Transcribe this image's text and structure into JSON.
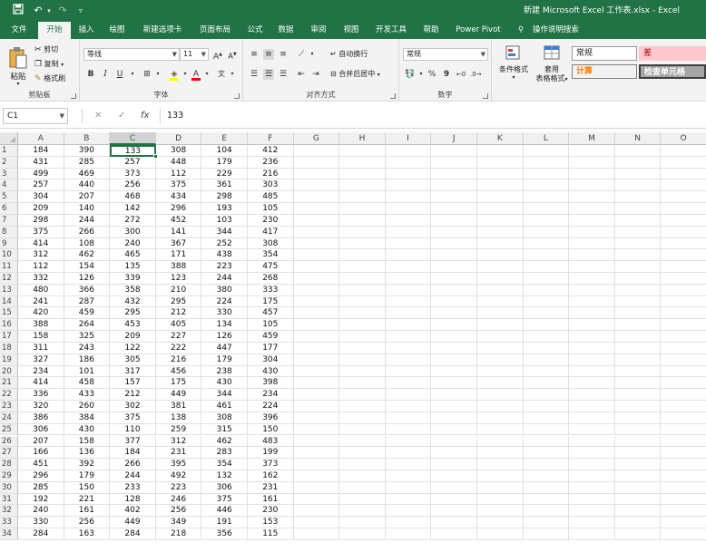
{
  "title_bar": {
    "title": "新建 Microsoft Excel 工作表.xlsx  -  Excel",
    "save_icon": "save-icon",
    "undo_icon": "undo-icon",
    "redo_icon": "redo-icon",
    "customize_icon": "customize-qat-icon"
  },
  "tabs": [
    "文件",
    "开始",
    "插入",
    "绘图",
    "新建选项卡",
    "页面布局",
    "公式",
    "数据",
    "审阅",
    "视图",
    "开发工具",
    "帮助",
    "Power Pivot"
  ],
  "active_tab": "开始",
  "tell_me": "操作说明搜索",
  "ribbon": {
    "clipboard": {
      "paste": "粘贴",
      "cut": "剪切",
      "copy": "复制",
      "format_painter": "格式刷",
      "label": "剪贴板"
    },
    "font": {
      "font_name": "等线",
      "font_size": "11",
      "grow": "A",
      "shrink": "A",
      "bold": "B",
      "italic": "I",
      "underline": "U",
      "font_color_letter": "A",
      "label": "字体"
    },
    "alignment": {
      "wrap_text": "自动换行",
      "merge_center": "合并后居中",
      "label": "对齐方式"
    },
    "number": {
      "format": "常规",
      "percent": "%",
      "comma": "9",
      "label": "数字"
    },
    "styles": {
      "conditional_formatting": "条件格式",
      "format_as_table": "套用",
      "format_as_table_2": "表格格式",
      "normal": "常规",
      "bad": "差",
      "calculation": "计算",
      "check_cell": "检查单元格"
    }
  },
  "formula_bar": {
    "name_box": "C1",
    "cancel": "✕",
    "enter": "✓",
    "fx": "fx",
    "formula": "133"
  },
  "sheet": {
    "columns": [
      "A",
      "B",
      "C",
      "D",
      "E",
      "F",
      "G",
      "H",
      "I",
      "J",
      "K",
      "L",
      "M",
      "N",
      "O"
    ],
    "selected_column": "C",
    "active_cell": "C1",
    "row_numbers": [
      "1",
      "2",
      "3",
      "4",
      "5",
      "6",
      "7",
      "8",
      "9",
      "10",
      "11",
      "12",
      "13",
      "14",
      "15",
      "16",
      "17",
      "18",
      "19",
      "20",
      "21",
      "22",
      "23",
      "24",
      "25",
      "26",
      "27",
      "28",
      "29",
      "30",
      "31",
      "32",
      "33",
      "34"
    ],
    "rows": [
      [
        "184",
        "390",
        "133",
        "308",
        "104",
        "412"
      ],
      [
        "431",
        "285",
        "257",
        "448",
        "179",
        "236"
      ],
      [
        "499",
        "469",
        "373",
        "112",
        "229",
        "216"
      ],
      [
        "257",
        "440",
        "256",
        "375",
        "361",
        "303"
      ],
      [
        "304",
        "207",
        "468",
        "434",
        "298",
        "485"
      ],
      [
        "209",
        "140",
        "142",
        "296",
        "193",
        "105"
      ],
      [
        "298",
        "244",
        "272",
        "452",
        "103",
        "230"
      ],
      [
        "375",
        "266",
        "300",
        "141",
        "344",
        "417"
      ],
      [
        "414",
        "108",
        "240",
        "367",
        "252",
        "308"
      ],
      [
        "312",
        "462",
        "465",
        "171",
        "438",
        "354"
      ],
      [
        "112",
        "154",
        "135",
        "388",
        "223",
        "475"
      ],
      [
        "332",
        "126",
        "339",
        "123",
        "244",
        "268"
      ],
      [
        "480",
        "366",
        "358",
        "210",
        "380",
        "333"
      ],
      [
        "241",
        "287",
        "432",
        "295",
        "224",
        "175"
      ],
      [
        "420",
        "459",
        "295",
        "212",
        "330",
        "457"
      ],
      [
        "388",
        "264",
        "453",
        "405",
        "134",
        "105"
      ],
      [
        "158",
        "325",
        "209",
        "227",
        "126",
        "459"
      ],
      [
        "311",
        "243",
        "122",
        "222",
        "447",
        "177"
      ],
      [
        "327",
        "186",
        "305",
        "216",
        "179",
        "304"
      ],
      [
        "234",
        "101",
        "317",
        "456",
        "238",
        "430"
      ],
      [
        "414",
        "458",
        "157",
        "175",
        "430",
        "398"
      ],
      [
        "336",
        "433",
        "212",
        "449",
        "344",
        "234"
      ],
      [
        "320",
        "260",
        "302",
        "381",
        "461",
        "224"
      ],
      [
        "386",
        "384",
        "375",
        "138",
        "308",
        "396"
      ],
      [
        "306",
        "430",
        "110",
        "259",
        "315",
        "150"
      ],
      [
        "207",
        "158",
        "377",
        "312",
        "462",
        "483"
      ],
      [
        "166",
        "136",
        "184",
        "231",
        "283",
        "199"
      ],
      [
        "451",
        "392",
        "266",
        "395",
        "354",
        "373"
      ],
      [
        "296",
        "179",
        "244",
        "492",
        "132",
        "162"
      ],
      [
        "285",
        "150",
        "233",
        "223",
        "306",
        "231"
      ],
      [
        "192",
        "221",
        "128",
        "246",
        "375",
        "161"
      ],
      [
        "240",
        "161",
        "402",
        "256",
        "446",
        "230"
      ],
      [
        "330",
        "256",
        "449",
        "349",
        "191",
        "153"
      ],
      [
        "284",
        "163",
        "284",
        "218",
        "356",
        "115"
      ]
    ]
  },
  "colors": {
    "accent": "#217346",
    "bad_fill": "#ffc7ce",
    "bad_text": "#9c0006",
    "calc_text": "#fa7d00",
    "check_fill": "#a5a5a5"
  }
}
